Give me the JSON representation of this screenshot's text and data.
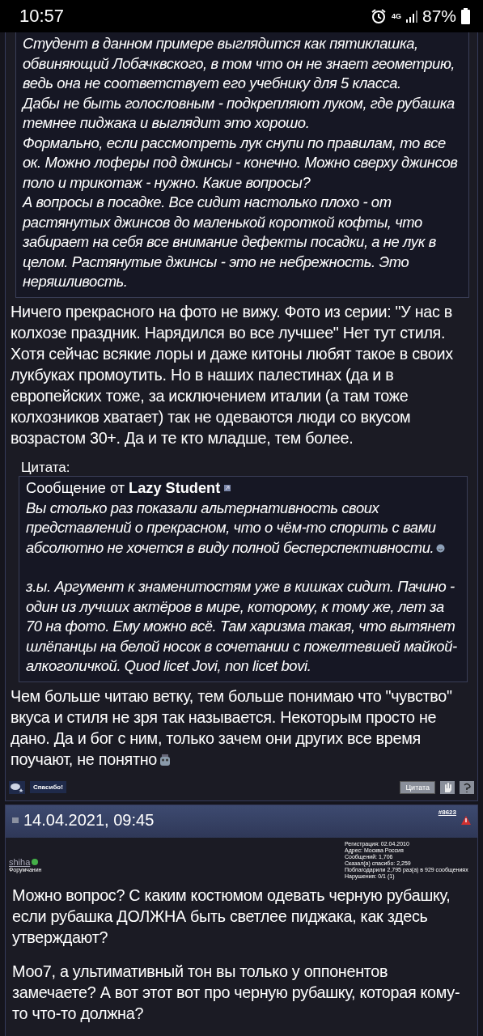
{
  "status_bar": {
    "time": "10:57",
    "network": "4G",
    "battery": "87%"
  },
  "quote_continuation": {
    "paragraphs": [
      "Студент в данном примере выглядится как пятиклашка, обвиняющий Лобачквского, в том что он не знает геометрию, ведь она не соответствует его учебнику для 5 класса.",
      "Дабы не быть голословным - подкрепляют луком, где рубашка темнее пиджака и выглядит это хорошо.",
      "Формально, если рассмотреть лук снупи по правилам, то все ок. Можно лоферы под джинсы - конечно. Можно сверху джинсов поло и трикотаж - нужно. Какие вопросы?",
      "А вопросы в посадке. Все сидит настолько плохо - от растянутых джинсов до маленькой короткой кофты, что забирает на себя все внимание дефекты посадки, а не лук в целом. Растянутые джинсы - это не небрежность. Это неряшливость."
    ]
  },
  "post_text_1": "Ничего прекрасного на фото не вижу. Фото из серии: \"У нас в колхозе праздник. Нарядился во все лучшее\" Нет тут стиля. Хотя сейчас всякие лоры и даже китоны любят такое в своих лукбуках промоутить. Но в наших палестинах (да и в европейских тоже, за исключением италии (а там тоже колхозников хватает) так не одеваются люди со вкусом возрастом 30+. Да и те кто младше, тем более.",
  "quote": {
    "label": "Цитата:",
    "author_prefix": "Сообщение от",
    "author": "Lazy Student",
    "paragraphs": [
      {
        "text": "Вы столько раз показали альтернативность своих представлений о прекрасном, что о чём-то спорить с вами абсолютно не хочется в виду полной бесперспективности.",
        "smiley": true
      },
      {
        "text": "з.ы. Аргумент к знаменитостям уже в кишках сидит. Пачино - один из лучших актёров в мире, которому, к тому же, лет за 70 на фото. Ему можно всё. Там харизма такая, что вытянет шлёпанцы на белой носок в сочетании с пожелтевшей майкой-алкоголичкой. Quod licet Jovi, non licet bovi.",
        "smiley": false
      }
    ]
  },
  "post_text_2": "Чем больше читаю ветку, тем больше понимаю что \"чувство\" вкуса и стиля не зря так называется. Некоторым просто не дано. Да и бог с ним, только зачем они других все время поучают, не понятно",
  "post_footer": {
    "thanks_button": "Спасибо!",
    "quote_button": "Цитата"
  },
  "next_post": {
    "date": "14.04.2021, 09:45",
    "number": "#8623",
    "user": {
      "name": "shiha",
      "online": true,
      "title": "Форумчанин"
    },
    "stats": [
      "Регистрация: 02.04.2010",
      "Адрес: Москва Россия",
      "Сообщений: 1,706",
      "Сказал(а) спасибо: 2,259",
      "Поблагодарили 2,795 раз(а) в 929 сообщениях",
      "Нарушения: 0/1 (1)"
    ],
    "paragraphs": [
      "Можно вопрос? С каким костюмом одевать черную рубашку, если рубашка ДОЛЖНА быть светлее пиджака, как здесь утверждают?",
      "Моо7, а ультимативный тон вы только у оппонентов замечаете? А вот этот вот про черную рубашку, которая кому-то что-то должна?"
    ]
  }
}
